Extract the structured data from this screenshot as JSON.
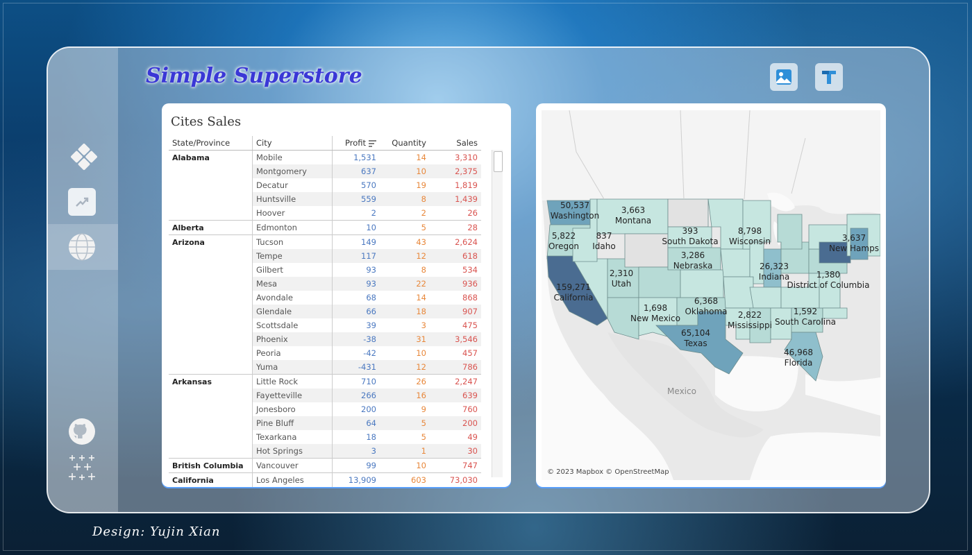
{
  "app": {
    "title": "Simple Superstore",
    "design_credit": "Design: Yujin Xian"
  },
  "sidebar": {
    "items": [
      {
        "icon": "diamond-grid-icon",
        "label": "Overview"
      },
      {
        "icon": "trend-chart-icon",
        "label": "Trends"
      },
      {
        "icon": "globe-icon",
        "label": "Map",
        "active": true
      }
    ],
    "bottom": [
      {
        "icon": "github-icon"
      },
      {
        "icon": "sparkle-icon"
      }
    ]
  },
  "toolbar": {
    "buttons": [
      {
        "icon": "image-icon"
      },
      {
        "icon": "tableau-icon"
      }
    ]
  },
  "table": {
    "title": "Cites Sales",
    "headers": [
      "State/Province",
      "City",
      "Profit",
      "Quantity",
      "Sales"
    ],
    "rows": [
      {
        "state": "Alabama",
        "city": "Mobile",
        "profit": "1,531",
        "qty": "14",
        "sales": "3,310"
      },
      {
        "state": "",
        "city": "Montgomery",
        "profit": "637",
        "qty": "10",
        "sales": "2,375"
      },
      {
        "state": "",
        "city": "Decatur",
        "profit": "570",
        "qty": "19",
        "sales": "1,819"
      },
      {
        "state": "",
        "city": "Huntsville",
        "profit": "559",
        "qty": "8",
        "sales": "1,439"
      },
      {
        "state": "",
        "city": "Hoover",
        "profit": "2",
        "qty": "2",
        "sales": "26"
      },
      {
        "state": "Alberta",
        "city": "Edmonton",
        "profit": "10",
        "qty": "5",
        "sales": "28"
      },
      {
        "state": "Arizona",
        "city": "Tucson",
        "profit": "149",
        "qty": "43",
        "sales": "2,624"
      },
      {
        "state": "",
        "city": "Tempe",
        "profit": "117",
        "qty": "12",
        "sales": "618"
      },
      {
        "state": "",
        "city": "Gilbert",
        "profit": "93",
        "qty": "8",
        "sales": "534"
      },
      {
        "state": "",
        "city": "Mesa",
        "profit": "93",
        "qty": "22",
        "sales": "936"
      },
      {
        "state": "",
        "city": "Avondale",
        "profit": "68",
        "qty": "14",
        "sales": "868"
      },
      {
        "state": "",
        "city": "Glendale",
        "profit": "66",
        "qty": "18",
        "sales": "907"
      },
      {
        "state": "",
        "city": "Scottsdale",
        "profit": "39",
        "qty": "3",
        "sales": "475"
      },
      {
        "state": "",
        "city": "Phoenix",
        "profit": "-38",
        "qty": "31",
        "sales": "3,546"
      },
      {
        "state": "",
        "city": "Peoria",
        "profit": "-42",
        "qty": "10",
        "sales": "457"
      },
      {
        "state": "",
        "city": "Yuma",
        "profit": "-431",
        "qty": "12",
        "sales": "786"
      },
      {
        "state": "Arkansas",
        "city": "Little Rock",
        "profit": "710",
        "qty": "26",
        "sales": "2,247"
      },
      {
        "state": "",
        "city": "Fayetteville",
        "profit": "266",
        "qty": "16",
        "sales": "639"
      },
      {
        "state": "",
        "city": "Jonesboro",
        "profit": "200",
        "qty": "9",
        "sales": "760"
      },
      {
        "state": "",
        "city": "Pine Bluff",
        "profit": "64",
        "qty": "5",
        "sales": "200"
      },
      {
        "state": "",
        "city": "Texarkana",
        "profit": "18",
        "qty": "5",
        "sales": "49"
      },
      {
        "state": "",
        "city": "Hot Springs",
        "profit": "3",
        "qty": "1",
        "sales": "30"
      },
      {
        "state": "British Columbia",
        "city": "Vancouver",
        "profit": "99",
        "qty": "10",
        "sales": "747"
      },
      {
        "state": "California",
        "city": "Los Angeles",
        "profit": "13,909",
        "qty": "603",
        "sales": "73,030"
      }
    ]
  },
  "map": {
    "credit": "© 2023 Mapbox © OpenStreetMap",
    "country_label": "Mexico",
    "labels": [
      {
        "value": "50,537",
        "name": "Washington"
      },
      {
        "value": "3,663",
        "name": "Montana"
      },
      {
        "value": "5,822",
        "name": "Oregon"
      },
      {
        "value": "837",
        "name": "Idaho"
      },
      {
        "value": "393",
        "name": "South Dakota"
      },
      {
        "value": "8,798",
        "name": "Wisconsin"
      },
      {
        "value": "3,286",
        "name": "Nebraska"
      },
      {
        "value": "2,310",
        "name": "Utah"
      },
      {
        "value": "159,271",
        "name": "California"
      },
      {
        "value": "26,323",
        "name": "Indiana"
      },
      {
        "value": "1,380",
        "name": "District of Columbia"
      },
      {
        "value": "3,637",
        "name": "New Hamps"
      },
      {
        "value": "1,698",
        "name": "New Mexico"
      },
      {
        "value": "6,368",
        "name": "Oklahoma"
      },
      {
        "value": "2,822",
        "name": "Mississippi"
      },
      {
        "value": "1,592",
        "name": "South Carolina"
      },
      {
        "value": "65,104",
        "name": "Texas"
      },
      {
        "value": "46,968",
        "name": "Florida"
      }
    ]
  }
}
